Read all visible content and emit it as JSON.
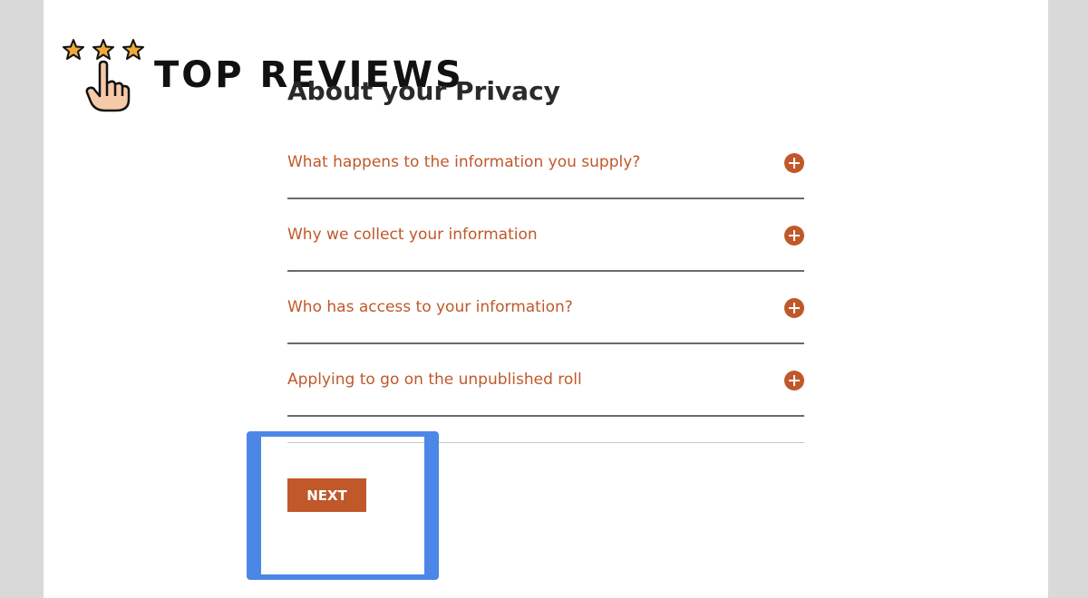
{
  "logo": {
    "text": "TOP REVIEWS"
  },
  "page": {
    "title": "About your Privacy"
  },
  "accordion": {
    "items": [
      {
        "label": "What happens to the information you supply?",
        "icon": "plus-circle-icon"
      },
      {
        "label": "Why we collect your information",
        "icon": "plus-circle-icon"
      },
      {
        "label": "Who has access to your information?",
        "icon": "plus-circle-icon"
      },
      {
        "label": "Applying to go on the unpublished roll",
        "icon": "plus-circle-icon"
      }
    ]
  },
  "actions": {
    "next_label": "NEXT"
  },
  "colors": {
    "accent": "#c0582a",
    "highlight": "#4c87e8",
    "title": "#2a2a2a",
    "background": "#d9d9d9"
  }
}
